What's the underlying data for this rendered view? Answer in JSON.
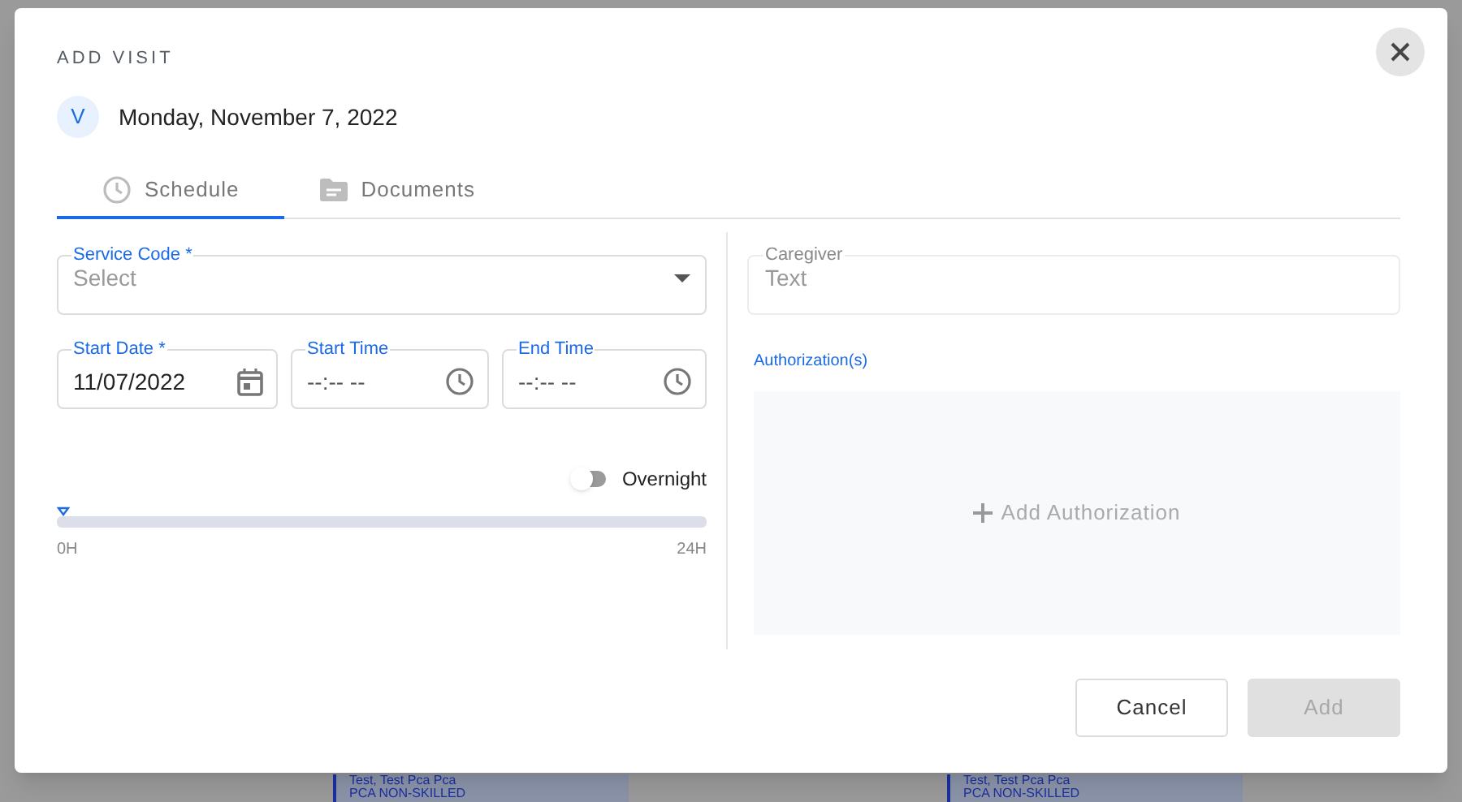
{
  "background_cards": [
    {
      "name": "Test, Test Pca Pca",
      "service": "PCA NON-SKILLED"
    },
    {
      "name": "Test, Test Pca Pca",
      "service": "PCA NON-SKILLED"
    }
  ],
  "dialog": {
    "title": "ADD VISIT",
    "avatar": "V",
    "date": "Monday, November 7, 2022",
    "tabs": [
      {
        "label": "Schedule",
        "kind": "schedule",
        "selected": true
      },
      {
        "label": "Documents",
        "kind": "documents",
        "selected": false
      }
    ],
    "service_code": {
      "label": "Service Code *",
      "placeholder": "Select"
    },
    "time_fields": [
      {
        "label": "Start Date *",
        "value": "11/07/2022",
        "kind": "date"
      },
      {
        "label": "Start Time",
        "value": "--:-- --",
        "kind": "time"
      },
      {
        "label": "End Time",
        "value": "--:-- --",
        "kind": "time"
      }
    ],
    "overnight": {
      "label": "Overnight",
      "on": false
    },
    "timeline": {
      "start_label": "0H",
      "end_label": "24H"
    },
    "caregiver": {
      "label": "Caregiver",
      "placeholder": "Text"
    },
    "authorizations": {
      "label": "Authorization(s)",
      "add_label": "Add Authorization"
    },
    "buttons": [
      {
        "label": "Cancel",
        "kind": "secondary",
        "disabled": false
      },
      {
        "label": "Add",
        "kind": "primary",
        "disabled": true
      }
    ]
  }
}
